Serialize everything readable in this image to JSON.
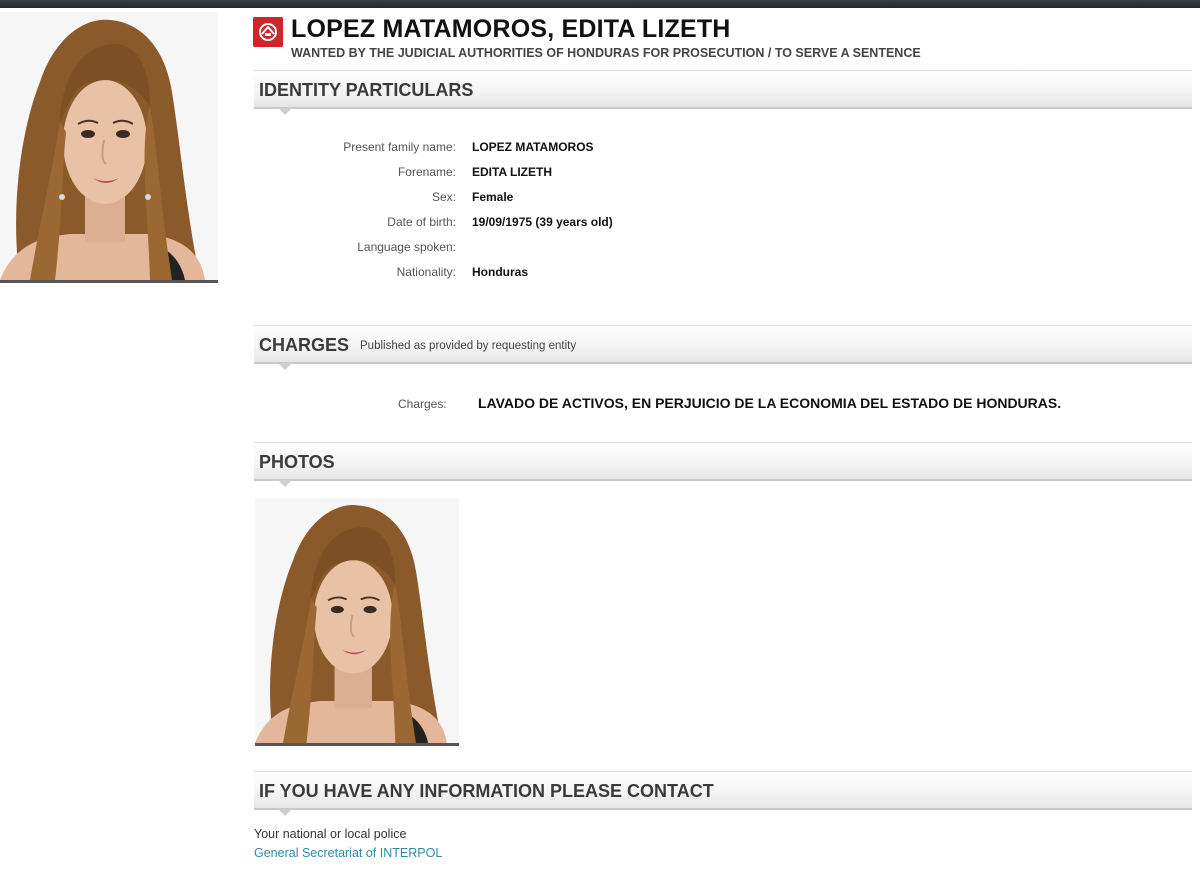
{
  "header": {
    "name": "LOPEZ MATAMOROS, EDITA LIZETH",
    "subtitle": "WANTED BY THE JUDICIAL AUTHORITIES OF HONDURAS FOR PROSECUTION / TO SERVE A SENTENCE",
    "notice_icon": "red-notice-icon",
    "notice_color": "#d2232a"
  },
  "identity": {
    "title": "IDENTITY PARTICULARS",
    "fields": [
      {
        "label": "Present family name:",
        "value": "LOPEZ MATAMOROS"
      },
      {
        "label": "Forename:",
        "value": "EDITA LIZETH"
      },
      {
        "label": "Sex:",
        "value": "Female"
      },
      {
        "label": "Date of birth:",
        "value": "19/09/1975 (39 years old)"
      },
      {
        "label": "Language spoken:",
        "value": ""
      },
      {
        "label": "Nationality:",
        "value": "Honduras"
      }
    ]
  },
  "charges": {
    "title": "CHARGES",
    "note": "Published as provided by requesting entity",
    "label": "Charges:",
    "value": "LAVADO DE ACTIVOS, EN PERJUICIO DE LA ECONOMIA DEL ESTADO DE HONDURAS."
  },
  "photos": {
    "title": "PHOTOS"
  },
  "contact": {
    "title": "IF YOU HAVE ANY INFORMATION PLEASE CONTACT",
    "police": "Your national or local police",
    "link": "General Secretariat of INTERPOL",
    "link_color": "#2c8ea5"
  }
}
